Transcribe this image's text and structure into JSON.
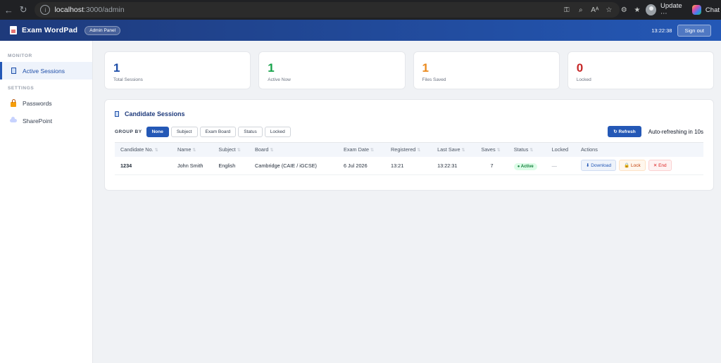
{
  "browser": {
    "url_host": "localhost",
    "url_path": ":3000/admin",
    "update_label": "Update",
    "chat_label": "Chat"
  },
  "header": {
    "title": "Exam WordPad",
    "badge": "Admin Panel",
    "clock": "13:22:38",
    "signout_label": "Sign out"
  },
  "sidebar": {
    "section_monitor": "MONITOR",
    "section_settings": "SETTINGS",
    "items": [
      {
        "label": "Active Sessions",
        "icon": "document-icon"
      },
      {
        "label": "Passwords",
        "icon": "lock-icon"
      },
      {
        "label": "SharePoint",
        "icon": "cloud-icon"
      }
    ]
  },
  "stats": [
    {
      "value": "1",
      "label": "Total Sessions",
      "color": "#1e4ea8"
    },
    {
      "value": "1",
      "label": "Active Now",
      "color": "#16a34a"
    },
    {
      "value": "1",
      "label": "Files Saved",
      "color": "#ea8a1e"
    },
    {
      "value": "0",
      "label": "Locked",
      "color": "#c62828"
    }
  ],
  "sessions": {
    "title": "Candidate Sessions",
    "group_by_label": "GROUP BY",
    "group_options": [
      "None",
      "Subject",
      "Exam Board",
      "Status",
      "Locked"
    ],
    "group_selected": "None",
    "refresh_label": "↻ Refresh",
    "auto_refresh_text": "Auto-refreshing in 10s",
    "columns": [
      "Candidate No.",
      "Name",
      "Subject",
      "Board",
      "Exam Date",
      "Registered",
      "Last Save",
      "Saves",
      "Status",
      "Locked",
      "Actions"
    ],
    "rows": [
      {
        "candidate_no": "1234",
        "name": "John Smith",
        "subject": "English",
        "board": "Cambridge (CAIE / iGCSE)",
        "exam_date": "6 Jul 2026",
        "registered": "13:21",
        "last_save": "13:22:31",
        "saves": "7",
        "status": "● Active",
        "locked": "—",
        "actions": {
          "download": "⬇ Download",
          "lock": "🔒 Lock",
          "end": "✕ End"
        }
      }
    ]
  }
}
